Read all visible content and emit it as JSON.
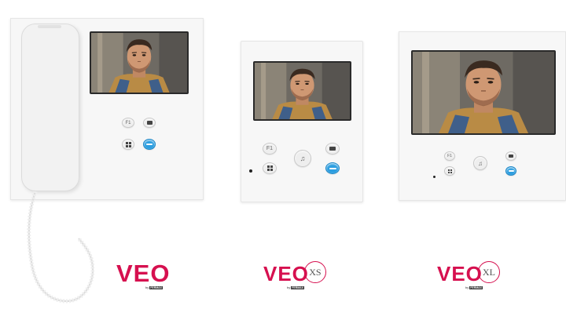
{
  "products": [
    {
      "name": "VEO",
      "suffix": "",
      "byline": "by",
      "brand": "FERMAX",
      "buttons": [
        "F1",
        "⊞",
        "▮◂",
        "⊸"
      ]
    },
    {
      "name": "VEO",
      "suffix": "XS",
      "byline": "by",
      "brand": "FERMAX",
      "buttons": [
        "F1",
        "⊞",
        "◍",
        "▮◂",
        "⊸"
      ]
    },
    {
      "name": "VEO",
      "suffix": "XL",
      "byline": "by",
      "brand": "FERMAX",
      "buttons": [
        "F1",
        "⊞",
        "◍",
        "▮◂",
        "⊸"
      ]
    }
  ],
  "colors": {
    "brand_pink": "#d6104f",
    "key_blue": "#2c9ee0",
    "panel": "#f7f7f7"
  },
  "icons": [
    "handset-icon",
    "camera-icon",
    "menu-grid-icon",
    "key-icon",
    "mute-icon"
  ]
}
